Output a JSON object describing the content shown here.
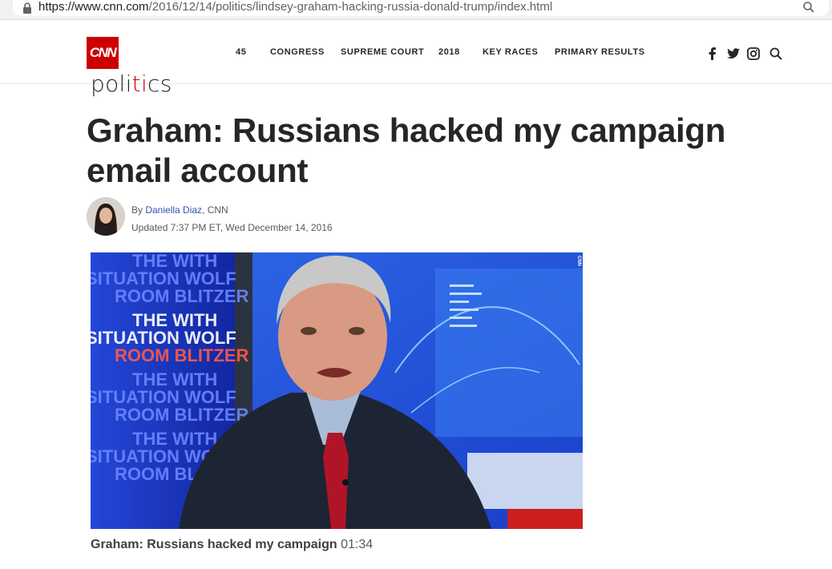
{
  "browser": {
    "url_host": "https://www.cnn.com",
    "url_path": "/2016/12/14/politics/lindsey-graham-hacking-russia-donald-trump/index.html"
  },
  "header": {
    "logo": "CNN",
    "nav": [
      "45",
      "CONGRESS",
      "SUPREME COURT",
      "2018",
      "KEY RACES",
      "PRIMARY RESULTS"
    ],
    "social_icons": [
      "facebook-icon",
      "twitter-icon",
      "instagram-icon",
      "search-icon"
    ]
  },
  "section": {
    "label_prefix": "poli",
    "label_accent": "ti",
    "label_suffix": "cs"
  },
  "article": {
    "headline": "Graham: Russians hacked my campaign email account",
    "byline_prefix": "By ",
    "author": "Daniella Diaz",
    "byline_suffix": ", CNN",
    "updated": "Updated 7:37 PM ET, Wed December 14, 2016"
  },
  "video": {
    "background_text": [
      "THE WITH",
      "SITUATION WOLF",
      "ROOM BLITZER"
    ],
    "watermark": "CNN",
    "caption_title": "Graham: Russians hacked my campaign",
    "caption_duration": " 01:34"
  },
  "colors": {
    "brand_red": "#cc0000",
    "link_blue": "#3355aa",
    "studio_blue": "#1a2fb5"
  }
}
